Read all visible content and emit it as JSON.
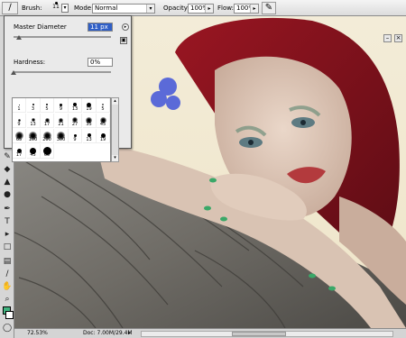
{
  "options_bar": {
    "brush_label": "Brush:",
    "brush_size": "11",
    "mode_label": "Mode:",
    "mode_value": "Normal",
    "opacity_label": "Opacity:",
    "opacity_value": "100%",
    "flow_label": "Flow:",
    "flow_value": "100%"
  },
  "brush_picker": {
    "master_diameter_label": "Master Diameter",
    "master_diameter_value": "11 px",
    "master_diameter_fraction": 0.06,
    "hardness_label": "Hardness:",
    "hardness_value": "0%",
    "hardness_fraction": 0.0,
    "presets": [
      {
        "size": "1",
        "soft": false
      },
      {
        "size": "3",
        "soft": false
      },
      {
        "size": "5",
        "soft": false
      },
      {
        "size": "9",
        "soft": false
      },
      {
        "size": "13",
        "soft": false
      },
      {
        "size": "19",
        "soft": false
      },
      {
        "size": "5",
        "soft": true
      },
      {
        "size": "9",
        "soft": true
      },
      {
        "size": "13",
        "soft": true
      },
      {
        "size": "17",
        "soft": true
      },
      {
        "size": "21",
        "soft": true
      },
      {
        "size": "27",
        "soft": true
      },
      {
        "size": "35",
        "soft": true
      },
      {
        "size": "45",
        "soft": true
      },
      {
        "size": "65",
        "soft": true
      },
      {
        "size": "100",
        "soft": true
      },
      {
        "size": "200",
        "soft": true
      },
      {
        "size": "300",
        "soft": true
      },
      {
        "size": "9",
        "soft": false
      },
      {
        "size": "13",
        "soft": false
      },
      {
        "size": "19",
        "soft": false
      },
      {
        "size": "17",
        "soft": false
      },
      {
        "size": "45",
        "soft": false
      },
      {
        "size": "65",
        "soft": false
      }
    ]
  },
  "status_bar": {
    "zoom": "72.53%",
    "doc": "Doc: 7.00M/29.4M"
  },
  "colors": {
    "foreground": "#3fb37f",
    "background": "#ffffff"
  }
}
